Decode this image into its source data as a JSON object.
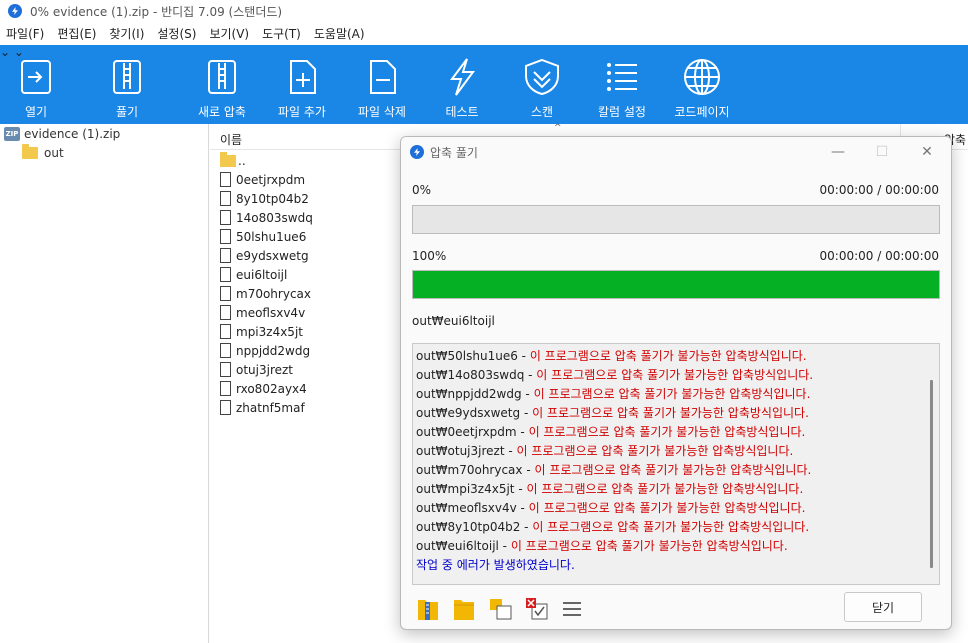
{
  "window": {
    "title": "0% evidence (1).zip - 반디집 7.09 (스탠더드)"
  },
  "menu": [
    "파일(F)",
    "편집(E)",
    "찾기(I)",
    "설정(S)",
    "보기(V)",
    "도구(T)",
    "도움말(A)"
  ],
  "toolbar": {
    "open": "열기",
    "extract": "풀기",
    "new_archive": "새로 압축",
    "add_file": "파일 추가",
    "delete_file": "파일 삭제",
    "test": "테스트",
    "scan": "스캔",
    "column_settings": "칼럼 설정",
    "codepage": "코드페이지"
  },
  "tree": {
    "root": "evidence (1).zip",
    "child": "out",
    "zip_badge": "ZIP"
  },
  "filelist": {
    "col_name": "이름",
    "col_compressed": "압축",
    "parent": "..",
    "files": [
      "0eetjrxpdm",
      "8y10tp04b2",
      "14o803swdq",
      "50lshu1ue6",
      "e9ydsxwetg",
      "eui6ltoijl",
      "m70ohrycax",
      "meoflsxv4v",
      "mpi3z4x5jt",
      "nppjdd2wdg",
      "otuj3jrezt",
      "rxo802ayx4",
      "zhatnf5maf"
    ]
  },
  "dialog": {
    "title": "압축 풀기",
    "progress1_label": "0%",
    "progress1_time": "00:00:00 / 00:00:00",
    "progress1_value": 0,
    "progress2_label": "100%",
    "progress2_time": "00:00:00 / 00:00:00",
    "progress2_value": 100,
    "current_file": "out₩eui6ltoijl",
    "log": [
      {
        "file": "out₩50lshu1ue6 - ",
        "msg": "이 프로그램으로 압축 풀기가 불가능한 압축방식입니다."
      },
      {
        "file": "out₩14o803swdq - ",
        "msg": "이 프로그램으로 압축 풀기가 불가능한 압축방식입니다."
      },
      {
        "file": "out₩nppjdd2wdg - ",
        "msg": "이 프로그램으로 압축 풀기가 불가능한 압축방식입니다."
      },
      {
        "file": "out₩e9ydsxwetg - ",
        "msg": "이 프로그램으로 압축 풀기가 불가능한 압축방식입니다."
      },
      {
        "file": "out₩0eetjrxpdm - ",
        "msg": "이 프로그램으로 압축 풀기가 불가능한 압축방식입니다."
      },
      {
        "file": "out₩otuj3jrezt - ",
        "msg": "이 프로그램으로 압축 풀기가 불가능한 압축방식입니다."
      },
      {
        "file": "out₩m70ohrycax - ",
        "msg": "이 프로그램으로 압축 풀기가 불가능한 압축방식입니다."
      },
      {
        "file": "out₩mpi3z4x5jt - ",
        "msg": "이 프로그램으로 압축 풀기가 불가능한 압축방식입니다."
      },
      {
        "file": "out₩meoflsxv4v - ",
        "msg": "이 프로그램으로 압축 풀기가 불가능한 압축방식입니다."
      },
      {
        "file": "out₩8y10tp04b2 - ",
        "msg": "이 프로그램으로 압축 풀기가 불가능한 압축방식입니다."
      },
      {
        "file": "out₩eui6ltoijl - ",
        "msg": "이 프로그램으로 압축 풀기가 불가능한 압축방식입니다."
      }
    ],
    "summary": "작업 중 에러가 발생하였습니다.",
    "close_label": "닫기"
  },
  "colors": {
    "toolbar": "#1a86e6",
    "progress_fill": "#06b025",
    "error_text": "#d00000",
    "summary_text": "#0000cc"
  }
}
